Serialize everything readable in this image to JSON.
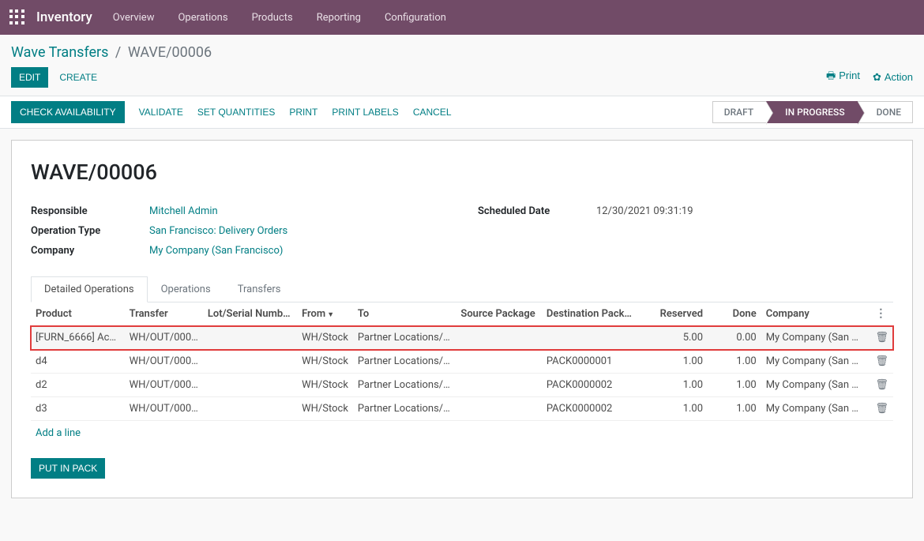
{
  "topbar": {
    "brand": "Inventory",
    "menu": [
      "Overview",
      "Operations",
      "Products",
      "Reporting",
      "Configuration"
    ]
  },
  "breadcrumb": {
    "root": "Wave Transfers",
    "leaf": "WAVE/00006"
  },
  "buttons": {
    "edit": "Edit",
    "create": "Create",
    "print": "Print",
    "action": "Action",
    "check_availability": "Check Availability",
    "validate": "Validate",
    "set_quantities": "Set Quantities",
    "print2": "Print",
    "print_labels": "Print Labels",
    "cancel": "Cancel",
    "put_in_pack": "Put in Pack",
    "add_line": "Add a line"
  },
  "status_steps": [
    "Draft",
    "In Progress",
    "Done"
  ],
  "status_active_index": 1,
  "record": {
    "title": "WAVE/00006",
    "fields": {
      "responsible_label": "Responsible",
      "responsible_value": "Mitchell Admin",
      "operation_type_label": "Operation Type",
      "operation_type_value": "San Francisco: Delivery Orders",
      "company_label": "Company",
      "company_value": "My Company (San Francisco)",
      "scheduled_date_label": "Scheduled Date",
      "scheduled_date_value": "12/30/2021 09:31:19"
    }
  },
  "tabs": [
    "Detailed Operations",
    "Operations",
    "Transfers"
  ],
  "active_tab_index": 0,
  "table": {
    "headers": [
      "Product",
      "Transfer",
      "Lot/Serial Numb…",
      "From",
      "To",
      "Source Package",
      "Destination Pack…",
      "Reserved",
      "Done",
      "Company"
    ],
    "sort_col_index": 3,
    "rows": [
      {
        "product": "[FURN_6666] Ac…",
        "transfer": "WH/OUT/000…",
        "lot": "",
        "from": "WH/Stock",
        "to": "Partner Locations/…",
        "src_pkg": "",
        "dst_pkg": "",
        "reserved": "5.00",
        "done": "0.00",
        "company": "My Company (San …",
        "highlight": true
      },
      {
        "product": "d4",
        "transfer": "WH/OUT/000…",
        "lot": "",
        "from": "WH/Stock",
        "to": "Partner Locations/…",
        "src_pkg": "",
        "dst_pkg": "PACK0000001",
        "reserved": "1.00",
        "done": "1.00",
        "company": "My Company (San …",
        "highlight": false
      },
      {
        "product": "d2",
        "transfer": "WH/OUT/000…",
        "lot": "",
        "from": "WH/Stock",
        "to": "Partner Locations/…",
        "src_pkg": "",
        "dst_pkg": "PACK0000002",
        "reserved": "1.00",
        "done": "1.00",
        "company": "My Company (San …",
        "highlight": false
      },
      {
        "product": "d3",
        "transfer": "WH/OUT/000…",
        "lot": "",
        "from": "WH/Stock",
        "to": "Partner Locations/…",
        "src_pkg": "",
        "dst_pkg": "PACK0000002",
        "reserved": "1.00",
        "done": "1.00",
        "company": "My Company (San …",
        "highlight": false
      }
    ]
  }
}
